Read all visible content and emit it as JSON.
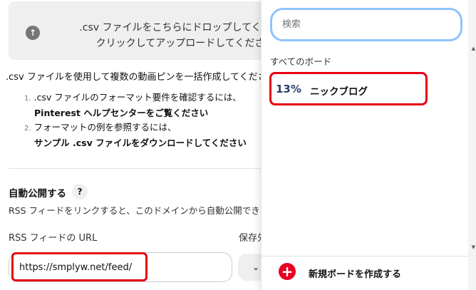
{
  "upload": {
    "line1": ".csv ファイルをこちらにドロップしてください",
    "line2": "クリックしてアップロードしてください"
  },
  "intro": ".csv ファイルを使用して複数の動画ピンを一括作成してください",
  "steps": [
    {
      "num": "1.",
      "text": ".csv ファイルのフォーマット要件を確認するには、",
      "bold": "Pinterest ヘルプセンターをご覧ください"
    },
    {
      "num": "2.",
      "text": "フォーマットの例を参照するには、",
      "bold": "サンプル .csv ファイルをダウンロードしてください"
    }
  ],
  "auto_publish": {
    "title": "自動公開する",
    "help": "?",
    "description": "RSS フィードをリンクすると、このドメインから自動公開できます"
  },
  "rss": {
    "label": "RSS フィードの URL",
    "value": "https://smplyw.net/feed/"
  },
  "save_to": {
    "label": "保存先",
    "chevron": "⌄"
  },
  "board_picker": {
    "search_placeholder": "検索",
    "section_label": "すべてのボード",
    "boards": [
      {
        "name": "ニックブログ",
        "thumb": "13%"
      }
    ],
    "create_label": "新規ボードを作成する",
    "create_icon": "+"
  },
  "colors": {
    "highlight": "#e60012",
    "pinterest_red": "#e60023",
    "search_focus": "#8fc3ff"
  }
}
